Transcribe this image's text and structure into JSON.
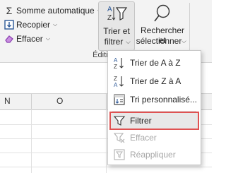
{
  "ribbon": {
    "autosum_label": "Somme automatique",
    "fill_label": "Recopier",
    "clear_label": "Effacer",
    "sort_filter_line1": "Trier et",
    "sort_filter_line2": "filtrer",
    "find_line1": "Rechercher et",
    "find_line2": "sélectionner",
    "group_label": "Édition"
  },
  "columns": [
    "N",
    "O"
  ],
  "menu": {
    "items": [
      {
        "label": "Trier de A à Z",
        "icon": "sort-a-z-icon",
        "enabled": true
      },
      {
        "label": "Trier de Z à A",
        "icon": "sort-z-a-icon",
        "enabled": true
      },
      {
        "label": "Tri personnalisé...",
        "icon": "custom-sort-icon",
        "enabled": true
      },
      {
        "label": "Filtrer",
        "icon": "filter-icon",
        "enabled": true,
        "selected": true
      },
      {
        "label": "Effacer",
        "icon": "clear-filter-icon",
        "enabled": false
      },
      {
        "label": "Réappliquer",
        "icon": "reapply-filter-icon",
        "enabled": false
      }
    ]
  },
  "colors": {
    "highlight_border": "#e05252",
    "accent_blue": "#2b5797",
    "eraser_purple": "#8a3fb0"
  }
}
